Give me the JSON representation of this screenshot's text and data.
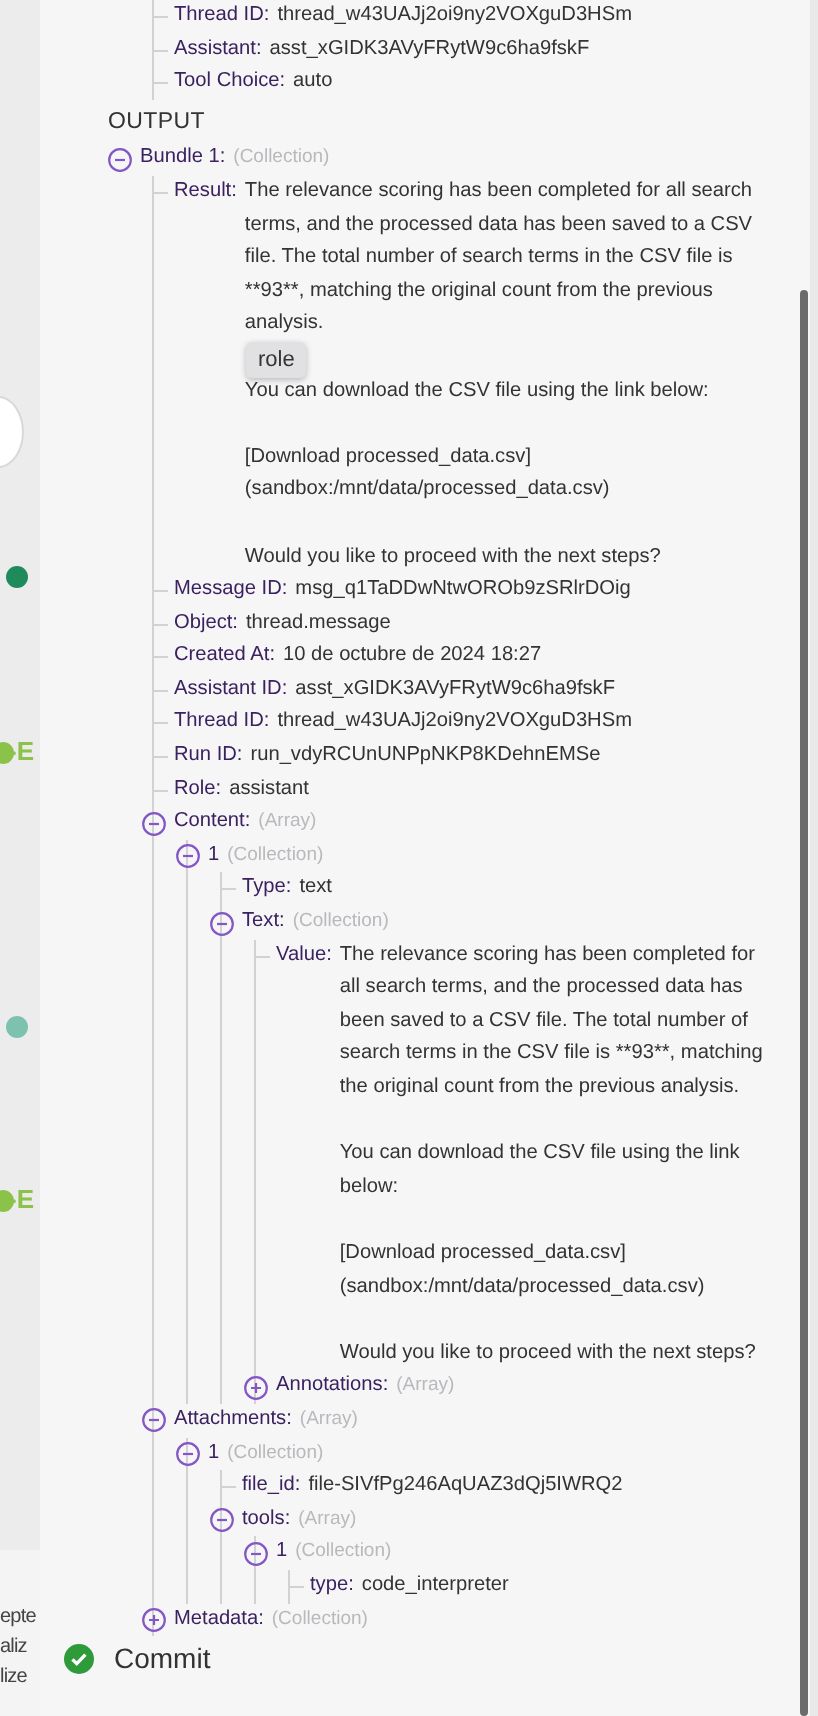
{
  "canvas": {
    "nodes": [
      {
        "kind": "dot",
        "color": "#1f8b5d"
      },
      {
        "kind": "dot",
        "color": "#8bc34a",
        "label": "-E"
      },
      {
        "kind": "dot",
        "color": "#7cc2ae"
      },
      {
        "kind": "dot",
        "color": "#8bc34a",
        "label": "-E"
      }
    ],
    "fragments": [
      "epte",
      "aliz",
      "lize"
    ]
  },
  "context_rows": [
    {
      "label": "Thread ID:",
      "value": "thread_w43UAJj2oi9ny2VOXguD3HSm"
    },
    {
      "label": "Assistant:",
      "value": "asst_xGIDK3AVyFRytW9c6ha9fskF"
    },
    {
      "label": "Tool Choice:",
      "value": "auto"
    }
  ],
  "output": {
    "title": "OUTPUT",
    "items": [
      {
        "kind": "group",
        "label": "Bundle 1:",
        "note": "(Collection)",
        "expanded": true,
        "children": [
          {
            "kind": "field",
            "label": "Result:",
            "paragraphs": [
              "The relevance scoring has been completed for all search terms, and the processed data has been saved to a CSV file. The total number of search terms in the CSV file is **93**, matching the original count from the previous analysis.",
              "You can download the CSV file using the link below:",
              "[Download processed_data.csv](sandbox:/mnt/data/processed_data.csv)",
              "Would you like to proceed with the next steps?"
            ],
            "tooltip": "role"
          },
          {
            "kind": "field",
            "label": "Message ID:",
            "value": "msg_q1TaDDwNtwOROb9zSRlrDOig"
          },
          {
            "kind": "field",
            "label": "Object:",
            "value": "thread.message"
          },
          {
            "kind": "field",
            "label": "Created At:",
            "value": "10 de octubre de 2024 18:27"
          },
          {
            "kind": "field",
            "label": "Assistant ID:",
            "value": "asst_xGIDK3AVyFRytW9c6ha9fskF"
          },
          {
            "kind": "field",
            "label": "Thread ID:",
            "value": "thread_w43UAJj2oi9ny2VOXguD3HSm"
          },
          {
            "kind": "field",
            "label": "Run ID:",
            "value": "run_vdyRCUnUNPpNKP8KDehnEMSe"
          },
          {
            "kind": "field",
            "label": "Role:",
            "value": "assistant"
          },
          {
            "kind": "group",
            "label": "Content:",
            "note": "(Array)",
            "expanded": true,
            "children": [
              {
                "kind": "group",
                "label": "1",
                "note": "(Collection)",
                "expanded": true,
                "children": [
                  {
                    "kind": "field",
                    "label": "Type:",
                    "value": "text"
                  },
                  {
                    "kind": "group",
                    "label": "Text:",
                    "note": "(Collection)",
                    "expanded": true,
                    "children": [
                      {
                        "kind": "field",
                        "label": "Value:",
                        "value": "The relevance scoring has been completed for all search terms, and the processed data has been saved to a CSV file. The total number of search terms in the CSV file is **93**, matching the original count from the previous analysis.\n\nYou can download the CSV file using the link below:\n\n[Download processed_data.csv](sandbox:/mnt/data/processed_data.csv)\n\nWould you like to proceed with the next steps?"
                      },
                      {
                        "kind": "group",
                        "label": "Annotations:",
                        "note": "(Array)",
                        "expanded": false
                      }
                    ]
                  }
                ]
              }
            ]
          },
          {
            "kind": "group",
            "label": "Attachments:",
            "note": "(Array)",
            "expanded": true,
            "children": [
              {
                "kind": "group",
                "label": "1",
                "note": "(Collection)",
                "expanded": true,
                "children": [
                  {
                    "kind": "field",
                    "label": "file_id:",
                    "value": "file-SIVfPg246AqUAZ3dQj5IWRQ2"
                  },
                  {
                    "kind": "group",
                    "label": "tools:",
                    "note": "(Array)",
                    "expanded": true,
                    "children": [
                      {
                        "kind": "group",
                        "label": "1",
                        "note": "(Collection)",
                        "expanded": true,
                        "children": [
                          {
                            "kind": "field",
                            "label": "type:",
                            "value": "code_interpreter"
                          }
                        ]
                      }
                    ]
                  }
                ]
              }
            ]
          },
          {
            "kind": "group",
            "label": "Metadata:",
            "note": "(Collection)",
            "expanded": false
          }
        ]
      }
    ]
  },
  "commit": {
    "label": "Commit",
    "completed": true
  }
}
